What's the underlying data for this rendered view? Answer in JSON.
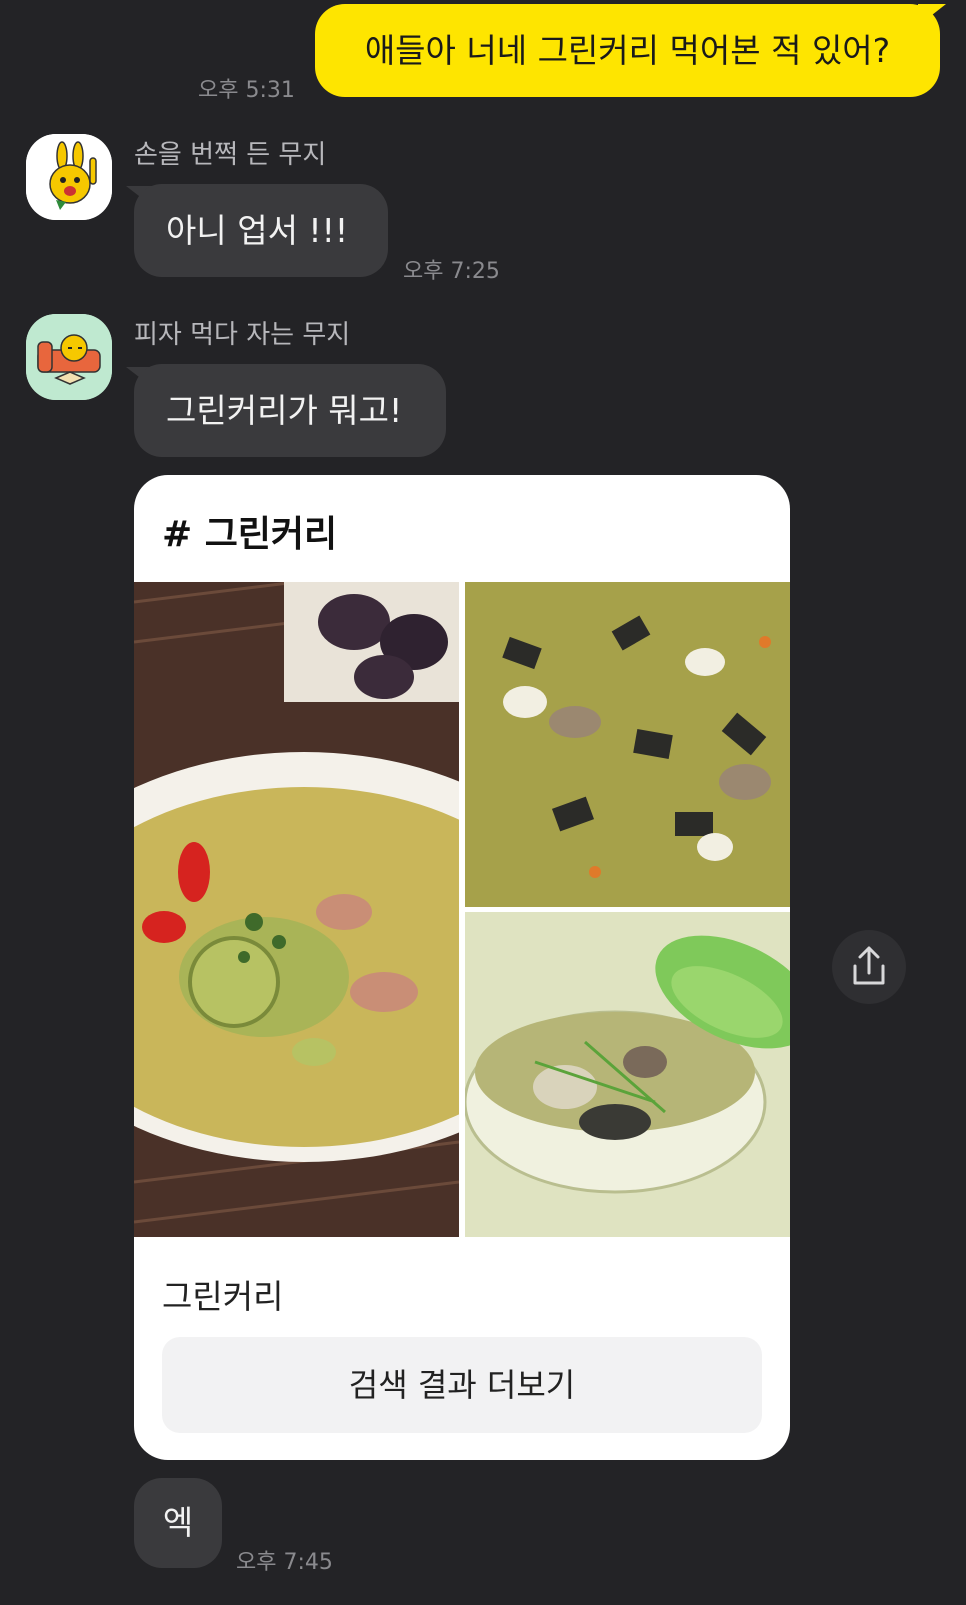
{
  "messages": {
    "my_message": {
      "text": "애들아 너네 그린커리 먹어본 적 있어?",
      "time": "오후 5:31"
    },
    "reply1": {
      "sender": "손을 번쩍 든 무지",
      "text": "아니 업서 !!!",
      "time": "오후 7:25"
    },
    "reply2": {
      "sender": "피자 먹다 자는 무지",
      "text": "그린커리가 뭐고!"
    },
    "search_card": {
      "title": "# 그린커리",
      "subtitle": "그린커리",
      "button_label": "검색 결과 더보기"
    },
    "reply3": {
      "text": "엑",
      "time": "오후 7:45"
    }
  },
  "icons": {
    "share": "share-icon",
    "avatar1": "muzi-raising-hand-avatar",
    "avatar2": "muzi-pizza-sleeping-avatar"
  },
  "colors": {
    "background": "#232326",
    "my_bubble": "#fee500",
    "other_bubble": "#3a3a3d",
    "card": "#ffffff"
  }
}
